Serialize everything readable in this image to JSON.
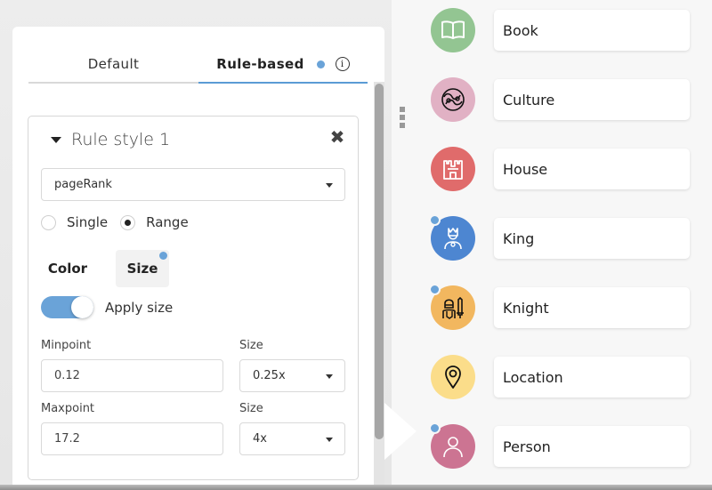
{
  "tabs": [
    {
      "label": "Default",
      "active": false
    },
    {
      "label": "Rule-based",
      "active": true,
      "has_dot": true
    }
  ],
  "rule": {
    "title": "Rule style 1",
    "property": "pageRank",
    "mode_options": [
      "Single",
      "Range"
    ],
    "mode_selected": "Range",
    "subtabs": [
      "Color",
      "Size"
    ],
    "subtab_active": "Size",
    "apply_label": "Apply size",
    "apply_on": true,
    "min_label": "Minpoint",
    "min_value": "0.12",
    "min_size_label": "Size",
    "min_size_value": "0.25x",
    "max_label": "Maxpoint",
    "max_value": "17.2",
    "max_size_label": "Size",
    "max_size_value": "4x"
  },
  "categories": [
    {
      "name": "Book",
      "icon": "book-icon",
      "color": "#93c592",
      "badge": false
    },
    {
      "name": "Culture",
      "icon": "yin-yang-icon",
      "color": "#e1b1c4",
      "badge": false
    },
    {
      "name": "House",
      "icon": "castle-icon",
      "color": "#e06b6b",
      "badge": false
    },
    {
      "name": "King",
      "icon": "king-icon",
      "color": "#4d86d1",
      "badge": true
    },
    {
      "name": "Knight",
      "icon": "knight-icon",
      "color": "#f2b75f",
      "badge": true
    },
    {
      "name": "Location",
      "icon": "location-pin-icon",
      "color": "#fbdd8a",
      "badge": false
    },
    {
      "name": "Person",
      "icon": "person-icon",
      "color": "#cc7492",
      "badge": true
    }
  ],
  "colors": {
    "accent": "#5b9bd5",
    "dot": "#6aa3d8"
  }
}
